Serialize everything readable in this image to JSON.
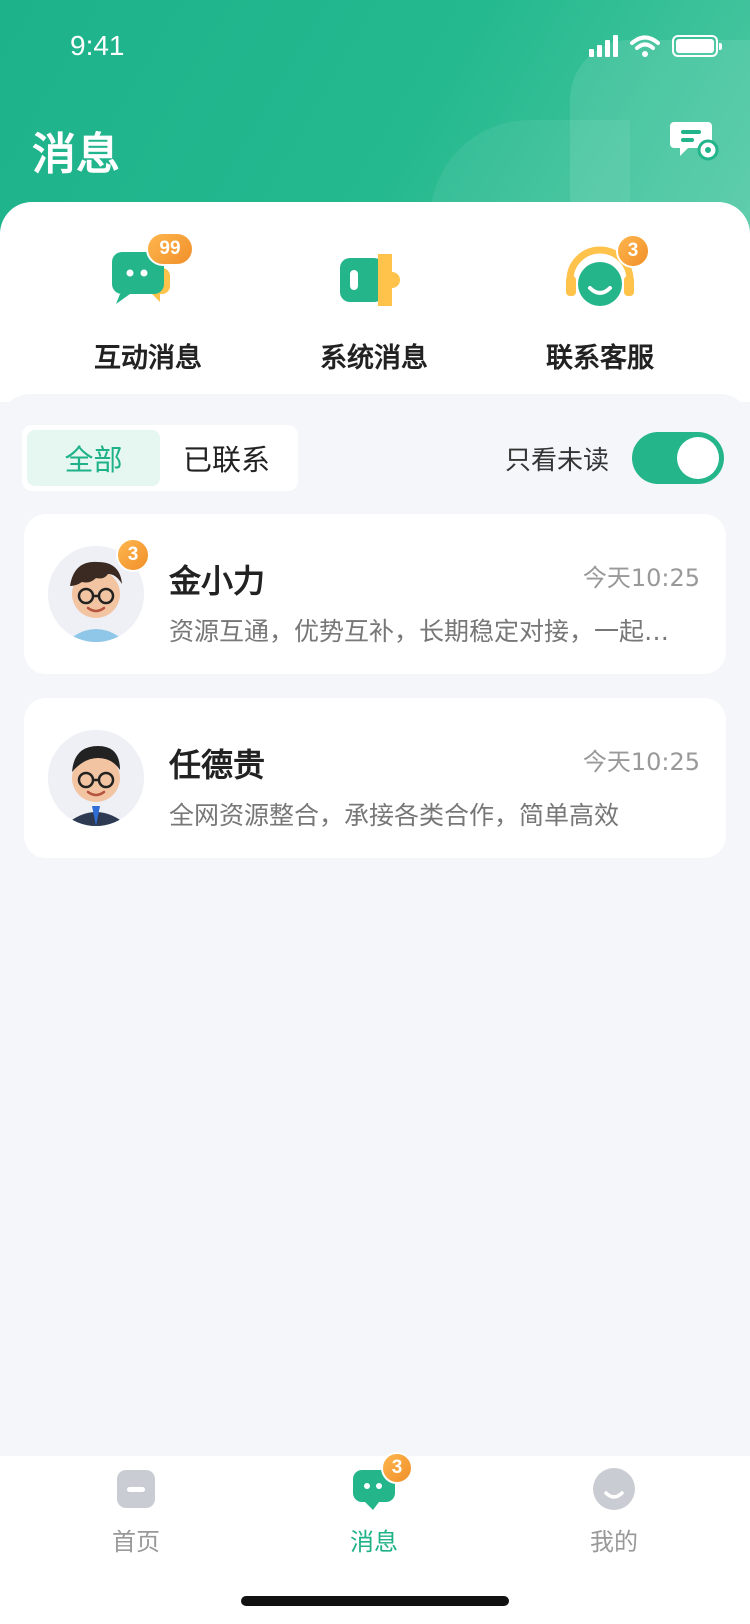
{
  "status": {
    "time": "9:41"
  },
  "header": {
    "title": "消息"
  },
  "entries": [
    {
      "label": "互动消息",
      "badge": "99",
      "icon": "chat-bubble-icon"
    },
    {
      "label": "系统消息",
      "badge": "",
      "icon": "megaphone-icon"
    },
    {
      "label": "联系客服",
      "badge": "3",
      "icon": "headset-icon"
    }
  ],
  "filter": {
    "segments": [
      "全部",
      "已联系"
    ],
    "active_segment": "全部",
    "unread_only_label": "只看未读",
    "unread_only_on": true
  },
  "chats": [
    {
      "name": "金小力",
      "time": "今天10:25",
      "preview": "资源互通，优势互补，长期稳定对接，一起共赢",
      "unread": "3"
    },
    {
      "name": "任德贵",
      "time": "今天10:25",
      "preview": "全网资源整合，承接各类合作，简单高效",
      "unread": ""
    }
  ],
  "tabbar": [
    {
      "label": "首页",
      "icon": "home-icon",
      "active": false
    },
    {
      "label": "消息",
      "icon": "message-icon",
      "active": true,
      "badge": "3"
    },
    {
      "label": "我的",
      "icon": "profile-icon",
      "active": false
    }
  ],
  "colors": {
    "accent": "#1fb187",
    "badge": "#f59a2f",
    "background": "#f4f6fa"
  }
}
